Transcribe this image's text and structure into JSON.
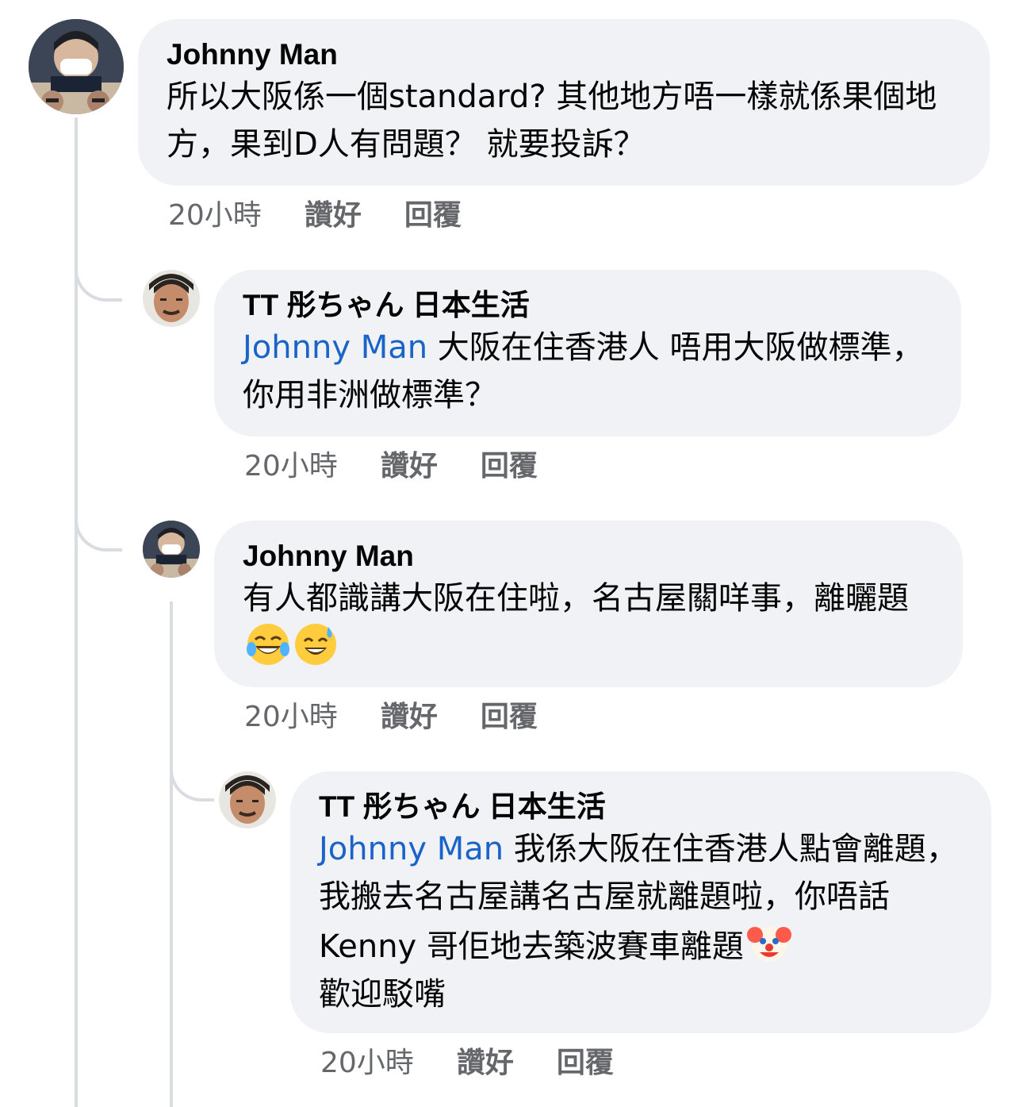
{
  "comments": [
    {
      "author": "Johnny Man",
      "mention": "",
      "text": "所以大阪係一個standard? 其他地方唔一樣就係果個地方，果到D人有問題？ 就要投訴？",
      "time": "20小時",
      "like": "讚好",
      "reply": "回覆",
      "avatar": "avatar-johnny-icon"
    },
    {
      "author": "TT 彤ちゃん 日本生活",
      "mention": "Johnny Man",
      "text": " 大阪在住香港人 唔用大阪做標準，你用非洲做標準？",
      "time": "20小時",
      "like": "讚好",
      "reply": "回覆",
      "avatar": "avatar-tt-icon"
    },
    {
      "author": "Johnny Man",
      "mention": "",
      "text": "有人都識講大阪在住啦，名古屋關咩事，離曬題",
      "emojis": [
        "laughing-tears-emoji",
        "sweat-smile-emoji"
      ],
      "time": "20小時",
      "like": "讚好",
      "reply": "回覆",
      "avatar": "avatar-johnny-icon"
    },
    {
      "author": "TT 彤ちゃん 日本生活",
      "mention": "Johnny Man",
      "text": " 我係大阪在住香港人點會離題，我搬去名古屋講名古屋就離題啦，你唔話 Kenny 哥佢地去築波賽車離題",
      "text_after_emoji": "歡迎駁嘴",
      "emojis": [
        "clown-face-emoji"
      ],
      "time": "20小時",
      "like": "讚好",
      "reply": "回覆",
      "avatar": "avatar-tt-icon"
    }
  ],
  "colors": {
    "bubble": "#f0f2f5",
    "mention": "#1a63c9",
    "meta": "#65676b",
    "thread_line": "#d9dce1"
  }
}
